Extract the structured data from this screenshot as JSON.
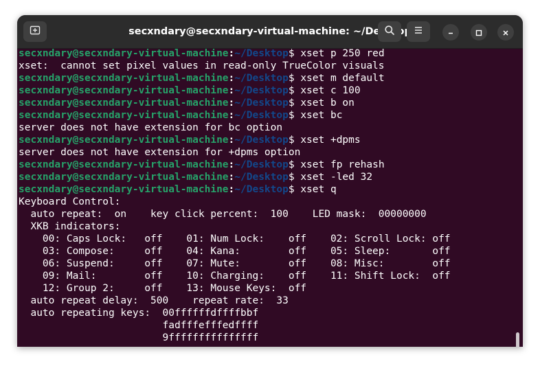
{
  "window": {
    "title": "secxndary@secxndary-virtual-machine: ~/Desktop"
  },
  "toolbar": {
    "new_tab_icon": "new-tab-icon",
    "search_icon": "search-icon",
    "menu_icon": "hamburger-menu-icon",
    "minimize_icon": "minimize-icon",
    "maximize_icon": "maximize-icon",
    "close_icon": "close-icon"
  },
  "prompt": {
    "user": "secxndary@secxndary-virtual-machine",
    "colon": ":",
    "path": "~/Desktop",
    "symbol": "$ "
  },
  "terminal": {
    "lines": [
      {
        "type": "prompt",
        "cmd": "xset p 250 red"
      },
      {
        "type": "text",
        "text": "xset:  cannot set pixel values in read-only TrueColor visuals"
      },
      {
        "type": "prompt",
        "cmd": "xset m default"
      },
      {
        "type": "prompt",
        "cmd": "xset c 100"
      },
      {
        "type": "prompt",
        "cmd": "xset b on"
      },
      {
        "type": "prompt",
        "cmd": "xset bc"
      },
      {
        "type": "text",
        "text": "server does not have extension for bc option"
      },
      {
        "type": "prompt",
        "cmd": "xset +dpms"
      },
      {
        "type": "text",
        "text": "server does not have extension for +dpms option"
      },
      {
        "type": "prompt",
        "cmd": "xset fp rehash"
      },
      {
        "type": "prompt",
        "cmd": "xset -led 32"
      },
      {
        "type": "prompt",
        "cmd": "xset q"
      },
      {
        "type": "text",
        "text": "Keyboard Control:"
      },
      {
        "type": "text",
        "text": "  auto repeat:  on    key click percent:  100    LED mask:  00000000"
      },
      {
        "type": "text",
        "text": "  XKB indicators:"
      },
      {
        "type": "text",
        "text": "    00: Caps Lock:   off    01: Num Lock:    off    02: Scroll Lock: off"
      },
      {
        "type": "text",
        "text": "    03: Compose:     off    04: Kana:        off    05: Sleep:       off"
      },
      {
        "type": "text",
        "text": "    06: Suspend:     off    07: Mute:        off    08: Misc:        off"
      },
      {
        "type": "text",
        "text": "    09: Mail:        off    10: Charging:    off    11: Shift Lock:  off"
      },
      {
        "type": "text",
        "text": "    12: Group 2:     off    13: Mouse Keys:  off"
      },
      {
        "type": "text",
        "text": "  auto repeat delay:  500    repeat rate:  33"
      },
      {
        "type": "text",
        "text": "  auto repeating keys:  00ffffffdffffbbf"
      },
      {
        "type": "text",
        "text": "                        fadfffefffedffff"
      },
      {
        "type": "text",
        "text": "                        9fffffffffffffff"
      }
    ]
  },
  "colors": {
    "terminal_bg": "#300a24",
    "titlebar_bg": "#2c2c2c",
    "prompt_user": "#26a269",
    "prompt_path": "#12488b",
    "text": "#ffffff"
  }
}
